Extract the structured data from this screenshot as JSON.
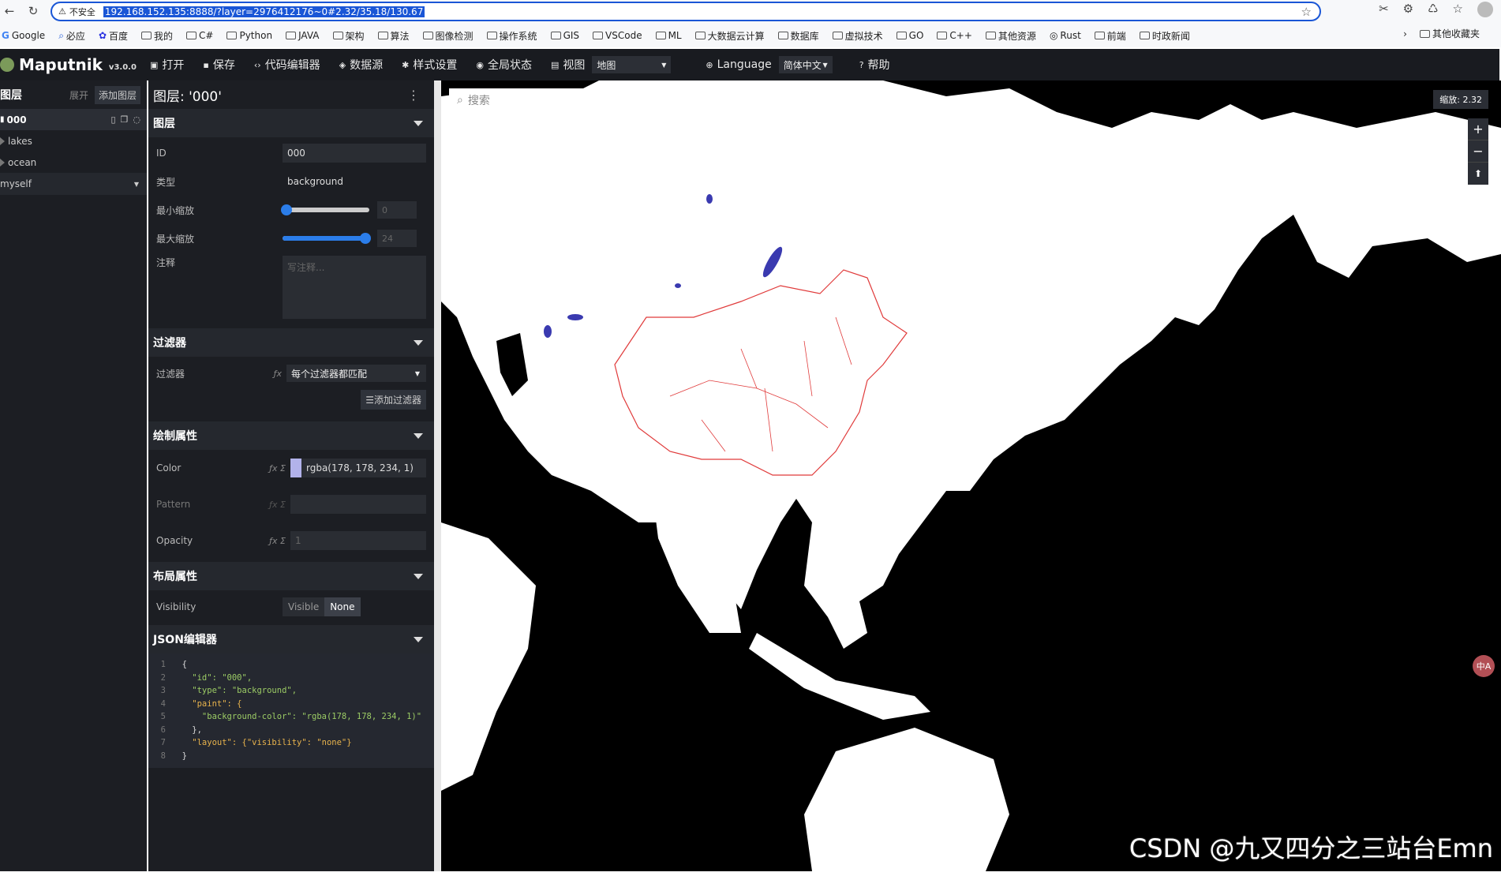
{
  "browser": {
    "insecure_label": "不安全",
    "url": "192.168.152.135:8888/?layer=2976412176~0#2.32/35.18/130.67",
    "bookmarks": [
      "Google",
      "必应",
      "百度",
      "我的",
      "C#",
      "Python",
      "JAVA",
      "架构",
      "算法",
      "图像检测",
      "操作系统",
      "GIS",
      "VSCode",
      "ML",
      "大数据云计算",
      "数据库",
      "虚拟技术",
      "GO",
      "C++",
      "其他资源",
      "Rust",
      "前端",
      "时政新闻"
    ],
    "bookmarks_other": "其他收藏夹"
  },
  "toolbar": {
    "app_name": "Maputnik",
    "version": "v3.0.0",
    "open": "打开",
    "save": "保存",
    "code_editor": "代码编辑器",
    "sources": "数据源",
    "style_settings": "样式设置",
    "global_state": "全局状态",
    "view": "视图",
    "view_value": "地图",
    "language": "Language",
    "language_value": "简体中文",
    "help": "帮助"
  },
  "layerlist": {
    "title": "图层",
    "expand": "展开",
    "add_layer": "添加图层",
    "items": [
      {
        "label": "000"
      },
      {
        "label": "lakes"
      },
      {
        "label": "ocean"
      }
    ],
    "group": "myself"
  },
  "editor": {
    "title": "图层: '000'",
    "sections": {
      "layer": "图层",
      "filter": "过滤器",
      "paint": "绘制属性",
      "layout": "布局属性",
      "json": "JSON编辑器"
    },
    "fields": {
      "id_label": "ID",
      "id_value": "000",
      "type_label": "类型",
      "type_value": "background",
      "minzoom_label": "最小缩放",
      "minzoom_value": "0",
      "maxzoom_label": "最大缩放",
      "maxzoom_value": "24",
      "comment_label": "注释",
      "comment_placeholder": "写注释...",
      "filter_label": "过滤器",
      "filter_value": "每个过滤器都匹配",
      "add_filter": "添加过滤器",
      "color_label": "Color",
      "color_value": "rgba(178, 178, 234, 1)",
      "pattern_label": "Pattern",
      "opacity_label": "Opacity",
      "opacity_value": "1",
      "visibility_label": "Visibility",
      "vis_visible": "Visible",
      "vis_none": "None"
    },
    "json_lines": [
      {
        "n": "1",
        "t": "  {"
      },
      {
        "n": "2",
        "t": "    \"id\": \"000\","
      },
      {
        "n": "3",
        "t": "    \"type\": \"background\","
      },
      {
        "n": "4",
        "t": "    \"paint\": {"
      },
      {
        "n": "5",
        "t": "      \"background-color\": \"rgba(178, 178, 234, 1)\""
      },
      {
        "n": "6",
        "t": "    },"
      },
      {
        "n": "7",
        "t": "    \"layout\": {\"visibility\": \"none\"}"
      },
      {
        "n": "8",
        "t": "  }"
      }
    ]
  },
  "map": {
    "search_placeholder": "搜索",
    "zoom_label": "缩放: 2.32",
    "watermark": "CSDN @九又四分之三站台Emn",
    "translate_icon_text": "中A"
  },
  "colors": {
    "accent": "#2b7de9",
    "border_red": "#e03a3a",
    "lake": "#3a3ab0"
  }
}
